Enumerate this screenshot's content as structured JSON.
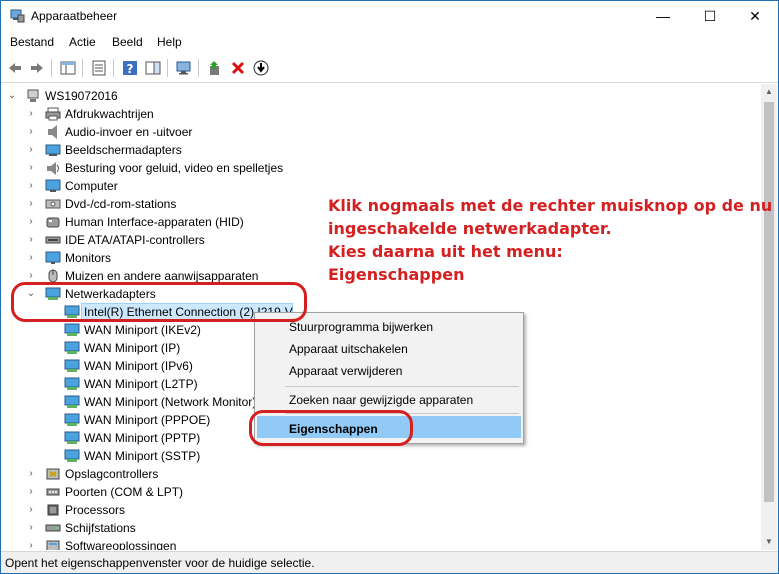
{
  "window": {
    "title": "Apparaatbeheer",
    "minimize": "—",
    "maximize": "☐",
    "close": "✕"
  },
  "menu": [
    "Bestand",
    "Actie",
    "Beeld",
    "Help"
  ],
  "tree": {
    "root": "WS19072016",
    "categories": [
      {
        "label": "Afdrukwachtrijen",
        "icon": "printer-icon"
      },
      {
        "label": "Audio-invoer en -uitvoer",
        "icon": "speaker-icon"
      },
      {
        "label": "Beeldschermadapters",
        "icon": "display-adapter-icon"
      },
      {
        "label": "Besturing voor geluid, video en spelletjes",
        "icon": "sound-icon"
      },
      {
        "label": "Computer",
        "icon": "computer-icon"
      },
      {
        "label": "Dvd-/cd-rom-stations",
        "icon": "dvd-icon"
      },
      {
        "label": "Human Interface-apparaten (HID)",
        "icon": "hid-icon"
      },
      {
        "label": "IDE ATA/ATAPI-controllers",
        "icon": "ide-icon"
      },
      {
        "label": "Monitors",
        "icon": "monitor-icon"
      },
      {
        "label": "Muizen en andere aanwijsapparaten",
        "icon": "mouse-icon"
      },
      {
        "label": "Netwerkadapters",
        "icon": "network-icon"
      }
    ],
    "network_adapters": [
      "Intel(R) Ethernet Connection (2) I219-V",
      "WAN Miniport (IKEv2)",
      "WAN Miniport (IP)",
      "WAN Miniport (IPv6)",
      "WAN Miniport (L2TP)",
      "WAN Miniport (Network Monitor)",
      "WAN Miniport (PPPOE)",
      "WAN Miniport (PPTP)",
      "WAN Miniport (SSTP)"
    ],
    "categories_after": [
      {
        "label": "Opslagcontrollers",
        "icon": "storage-icon"
      },
      {
        "label": "Poorten (COM & LPT)",
        "icon": "port-icon"
      },
      {
        "label": "Processors",
        "icon": "processor-icon"
      },
      {
        "label": "Schijfstations",
        "icon": "disk-icon"
      },
      {
        "label": "Softwareoplossingen",
        "icon": "software-icon"
      }
    ]
  },
  "context_menu": {
    "items": [
      "Stuurprogramma bijwerken",
      "Apparaat uitschakelen",
      "Apparaat verwijderen",
      "Zoeken naar gewijzigde apparaten",
      "Eigenschappen"
    ]
  },
  "annotation": {
    "lines": [
      "Klik nogmaals met de rechter muisknop op de nu",
      "ingeschakelde netwerkadapter.",
      "Kies daarna uit het menu:",
      "Eigenschappen"
    ],
    "color": "#d42020"
  },
  "status": "Opent het eigenschappenvenster voor de huidige selectie."
}
